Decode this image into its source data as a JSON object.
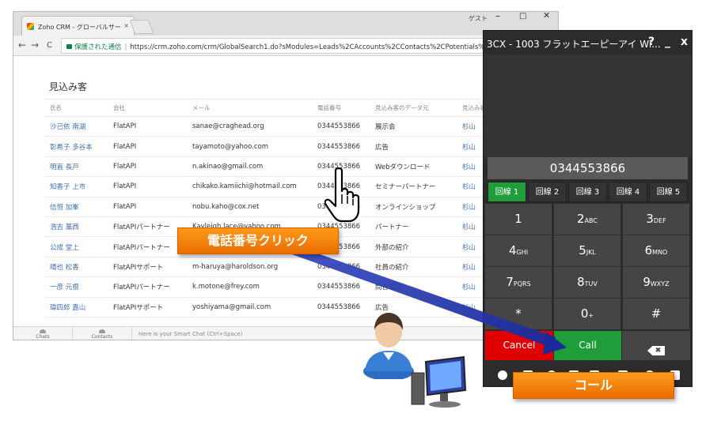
{
  "browser": {
    "tab_title": "Zoho CRM - グローバルサー",
    "tab_close": "×",
    "nav": {
      "back": "←",
      "forward": "→",
      "reload": "C"
    },
    "secure_label": "保護された通信",
    "url": "https://crm.zoho.com/crm/GlobalSearch1.do?sModules=Leads%2CAccounts%2CContacts%2CPotentials%2CProduct"
  },
  "system": {
    "guest_label": "ゲスト",
    "minimize": "–",
    "maximize": "□",
    "close": "✕"
  },
  "crm": {
    "section_title": "見込み客",
    "columns": [
      "氏名",
      "会社",
      "メール",
      "電話番号",
      "見込み客のデータ元",
      "見込み客"
    ],
    "rows": [
      [
        "沙己依 南湖",
        "FlatAPI",
        "sanae@craghead.org",
        "0344553866",
        "展示会",
        "杉山　知"
      ],
      [
        "彰希子 多谷本",
        "FlatAPI",
        "tayamoto@yahoo.com",
        "0344553866",
        "広告",
        "杉山　知"
      ],
      [
        "明直 長戸",
        "FlatAPI",
        "n.akinao@gmail.com",
        "0344553866",
        "Webダウンロード",
        "杉山　知"
      ],
      [
        "知香子 上市",
        "FlatAPI",
        "chikako.kamiichi@hotmail.com",
        "0344553866",
        "セミナーパートナー",
        "杉山　知"
      ],
      [
        "信恒 加峯",
        "FlatAPI",
        "nobu.kaho@cox.net",
        "0344553866",
        "オンラインショップ",
        "杉山　知"
      ],
      [
        "浩吉 藁西",
        "FlatAPIパートナー",
        "Kayleigh.lace@yahoo.com",
        "0344553866",
        "パートナー",
        "杉山　知"
      ],
      [
        "公成 堂上",
        "FlatAPIパートナー",
        "",
        "0344553866",
        "外部の紹介",
        "杉山　知"
      ],
      [
        "晴也 松香",
        "FlatAPIサポート",
        "m-haruya@haroldson.org",
        "0344553866",
        "社員の紹介",
        "杉山　知"
      ],
      [
        "一彦 元根",
        "FlatAPIパートナー",
        "k.motone@frey.com",
        "0344553866",
        "問合電話",
        "杉山　知"
      ],
      [
        "瑋四郎 嘉山",
        "FlatAPIサポート",
        "yoshiyama@gmail.com",
        "0344553866",
        "広告",
        "杉山　知"
      ]
    ]
  },
  "chatbar": {
    "chats": "Chats",
    "contacts": "Contacts",
    "hint": "Here is your Smart Chat (Ctrl+Space)"
  },
  "phone": {
    "title": "3CX - 1003 フラットエーピーアイ Wi...",
    "help": "?",
    "minimize": "_",
    "close": "x",
    "number": "0344553866",
    "lines": [
      "回線 1",
      "回線 2",
      "回線 3",
      "回線 4",
      "回線 5"
    ],
    "keys": [
      {
        "main": "1",
        "sub": ""
      },
      {
        "main": "2",
        "sub": "ABC"
      },
      {
        "main": "3",
        "sub": "DEF"
      },
      {
        "main": "4",
        "sub": "GHI"
      },
      {
        "main": "5",
        "sub": "JKL"
      },
      {
        "main": "6",
        "sub": "MNO"
      },
      {
        "main": "7",
        "sub": "PQRS"
      },
      {
        "main": "8",
        "sub": "TUV"
      },
      {
        "main": "9",
        "sub": "WXYZ"
      },
      {
        "main": "*",
        "sub": ""
      },
      {
        "main": "0",
        "sub": "+"
      },
      {
        "main": "#",
        "sub": ""
      }
    ],
    "cancel_label": "Cancel",
    "call_label": "Call",
    "backspace_glyph": "✖",
    "colors": {
      "active_line": "#1f9d3a",
      "cancel": "#e00000",
      "call": "#1f9d3a"
    }
  },
  "callouts": {
    "click_label": "電話番号クリック",
    "call_label": "コール"
  },
  "icons": [
    "favicon-icon",
    "lock-icon",
    "hand-cursor-icon",
    "person-icon",
    "computer-icon",
    "backspace-icon"
  ]
}
